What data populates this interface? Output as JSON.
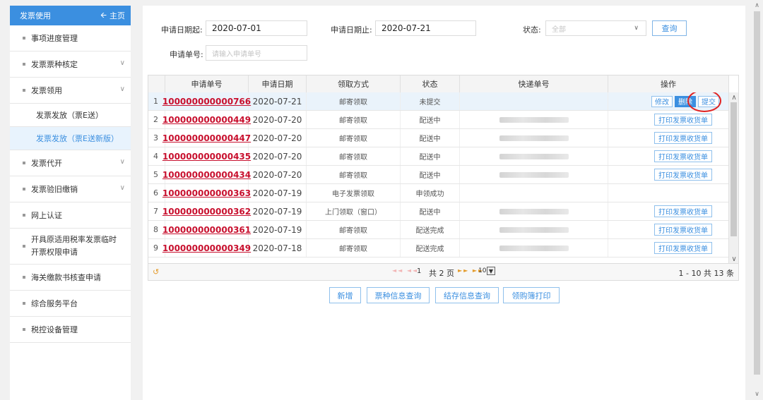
{
  "sidebar": {
    "title": "发票使用",
    "home_label": "主页",
    "items": [
      {
        "label": "事项进度管理"
      },
      {
        "label": "发票票种核定"
      },
      {
        "label": "发票领用"
      },
      {
        "label": "发票代开"
      },
      {
        "label": "发票验旧缴销"
      },
      {
        "label": "网上认证"
      },
      {
        "label_line1": "开具原适用税率发票临时",
        "label_line2": "开票权限申请"
      },
      {
        "label": "海关缴款书核查申请"
      },
      {
        "label": "综合服务平台"
      },
      {
        "label": "税控设备管理"
      }
    ],
    "subitems": [
      {
        "label": "发票发放（票E送）"
      },
      {
        "label": "发票发放（票E送新版）"
      }
    ]
  },
  "form": {
    "start_label": "申请日期起:",
    "start_value": "2020-07-01",
    "end_label": "申请日期止:",
    "end_value": "2020-07-21",
    "status_label": "状态:",
    "status_value": "全部",
    "query_label": "查询",
    "number_label": "申请单号:",
    "number_placeholder": "请输入申请单号"
  },
  "table": {
    "headers": [
      "申请单号",
      "申请日期",
      "领取方式",
      "状态",
      "快递单号",
      "操作"
    ],
    "rows": [
      {
        "n": "1",
        "id": "100000000000766",
        "date": "2020-07-21",
        "method": "邮寄领取",
        "status": "未提交",
        "ops": [
          "修改",
          "删除",
          "提交"
        ]
      },
      {
        "n": "2",
        "id": "100000000000449",
        "date": "2020-07-20",
        "method": "邮寄领取",
        "status": "配送中",
        "print": "打印发票收货单"
      },
      {
        "n": "3",
        "id": "100000000000447",
        "date": "2020-07-20",
        "method": "邮寄领取",
        "status": "配送中",
        "print": "打印发票收货单"
      },
      {
        "n": "4",
        "id": "100000000000435",
        "date": "2020-07-20",
        "method": "邮寄领取",
        "status": "配送中",
        "print": "打印发票收货单"
      },
      {
        "n": "5",
        "id": "100000000000434",
        "date": "2020-07-20",
        "method": "邮寄领取",
        "status": "配送中",
        "print": "打印发票收货单"
      },
      {
        "n": "6",
        "id": "100000000000363",
        "date": "2020-07-19",
        "method": "电子发票领取",
        "status": "申领成功"
      },
      {
        "n": "7",
        "id": "100000000000362",
        "date": "2020-07-19",
        "method": "上门领取（窗口）",
        "status": "配送中",
        "print": "打印发票收货单"
      },
      {
        "n": "8",
        "id": "100000000000361",
        "date": "2020-07-19",
        "method": "邮寄领取",
        "status": "配送完成",
        "print": "打印发票收货单"
      },
      {
        "n": "9",
        "id": "100000000000349",
        "date": "2020-07-18",
        "method": "邮寄领取",
        "status": "配送完成",
        "print": "打印发票收货单"
      }
    ]
  },
  "pager": {
    "page": "1",
    "total_pages": "共 2 页",
    "page_size": "10",
    "range": "1 - 10  共 13 条"
  },
  "actions": {
    "add": "新增",
    "type_query": "票种信息查询",
    "stock_query": "结存信息查询",
    "ledger_print": "领购簿打印"
  },
  "colors": {
    "accent": "#3b8fe0",
    "link_red": "#c8102e",
    "highlight_circle": "#e02424"
  }
}
